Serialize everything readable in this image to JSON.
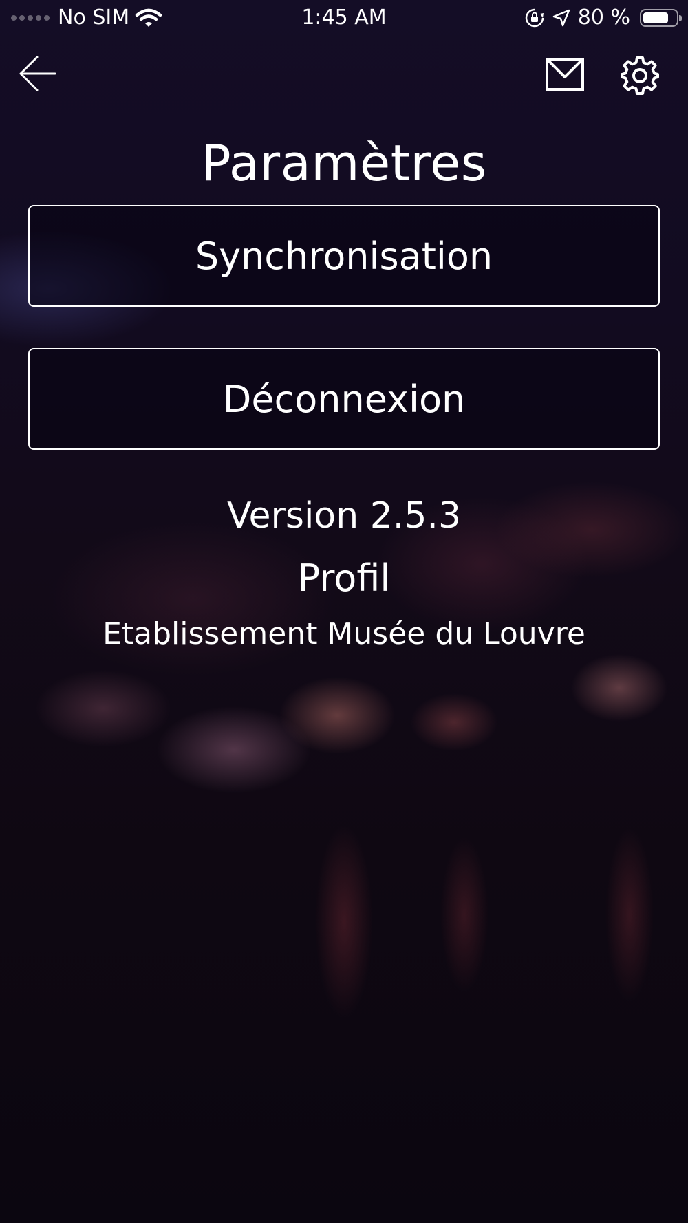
{
  "status_bar": {
    "carrier": "No SIM",
    "time": "1:45 AM",
    "battery": "80 %",
    "battery_level": 0.8
  },
  "nav": {
    "back_icon": "arrow-left-icon",
    "mail_icon": "envelope-icon",
    "settings_icon": "gear-icon"
  },
  "page": {
    "title": "Paramètres"
  },
  "actions": {
    "sync_label": "Synchronisation",
    "logout_label": "Déconnexion"
  },
  "info": {
    "version": "Version 2.5.3",
    "profile_label": "Profil",
    "profile_value": "Etablissement Musée du Louvre"
  },
  "colors": {
    "text": "#ffffff",
    "background_top": "#140d26",
    "background_bottom": "#0b0610"
  }
}
